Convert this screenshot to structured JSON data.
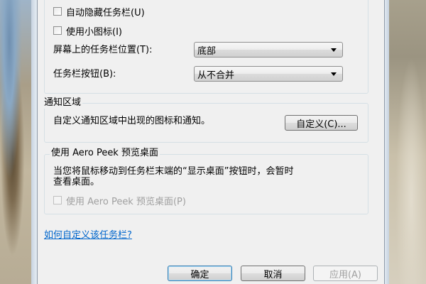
{
  "taskbar": {
    "autohide_label": "自动隐藏任务栏(U)",
    "small_icons_label": "使用小图标(I)",
    "location_label": "屏幕上的任务栏位置(T):",
    "location_value": "底部",
    "buttons_label": "任务栏按钮(B):",
    "buttons_value": "从不合并"
  },
  "notification": {
    "title": "通知区域",
    "description": "自定义通知区域中出现的图标和通知。",
    "customize_button": "自定义(C)..."
  },
  "aero_peek": {
    "title": "使用 Aero Peek 预览桌面",
    "description_line1": "当您将鼠标移动到任务栏末端的“显示桌面”按钮时，会暂时",
    "description_line2": "查看桌面。",
    "checkbox_label": "使用 Aero Peek 预览桌面(P)"
  },
  "help_link": "如何自定义该任务栏?",
  "buttons": {
    "ok": "确定",
    "cancel": "取消",
    "apply": "应用(A)"
  }
}
